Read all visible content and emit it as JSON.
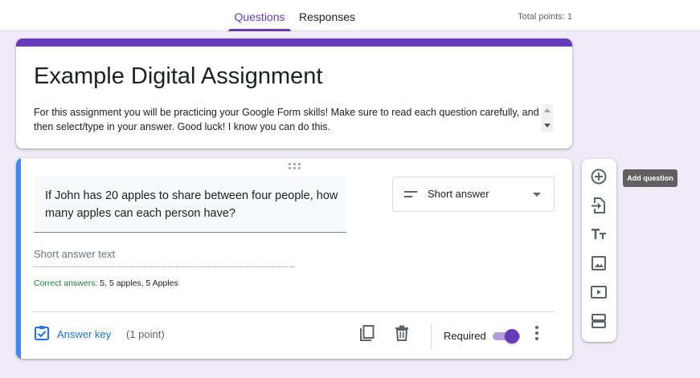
{
  "tabs": [
    {
      "label": "Questions",
      "active": true
    },
    {
      "label": "Responses",
      "active": false
    }
  ],
  "total_points": "Total points: 1",
  "colors": {
    "theme": "#673ab7",
    "background": "#f0ebf8",
    "focus_bar": "#4285f4",
    "link": "#1a73e8",
    "correct_label": "#188038"
  },
  "form": {
    "title": "Example Digital Assignment",
    "description": "For this assignment you will be practicing your Google Form skills!  Make sure to read each question carefully, and then select/type in your answer.  Good luck! I know you can do this."
  },
  "question": {
    "text": "If John has 20 apples to share between four people, how many apples can each person have?",
    "type": "Short answer",
    "type_icon": "short-text-icon",
    "answer_placeholder": "Short answer text",
    "correct_label": "Correct answers:",
    "correct_values": "5, 5 apples, 5 Apples",
    "answer_key_label": "Answer key",
    "points": "(1 point)",
    "required_label": "Required",
    "required": true
  },
  "toolbar": {
    "items": [
      "add-question-icon",
      "import-questions-icon",
      "add-title-icon",
      "add-image-icon",
      "add-video-icon",
      "add-section-icon"
    ],
    "tooltip": "Add question"
  }
}
